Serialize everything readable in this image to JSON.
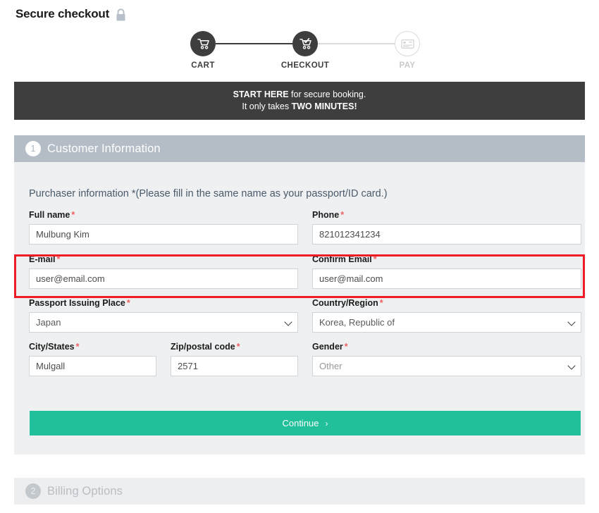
{
  "header": {
    "title": "Secure checkout",
    "lock_icon": "lock-icon"
  },
  "stepper": {
    "steps": [
      {
        "label": "CART",
        "icon": "shopping-cart-icon",
        "state": "done"
      },
      {
        "label": "CHECKOUT",
        "icon": "cart-check-icon",
        "state": "done"
      },
      {
        "label": "PAY",
        "icon": "credit-card-icon",
        "state": "todo"
      }
    ]
  },
  "banner": {
    "line1_strong": "START HERE",
    "line1_rest": " for secure booking.",
    "line2_rest": "It only takes ",
    "line2_strong": "TWO MINUTES!"
  },
  "sections": {
    "customer": {
      "number": "1",
      "title": "Customer Information"
    },
    "billing": {
      "number": "2",
      "title": "Billing Options"
    }
  },
  "form": {
    "note": "Purchaser information *(Please fill in the same name as your passport/ID card.)",
    "fields": {
      "full_name": {
        "label": "Full name",
        "required": "*",
        "value": "Mulbung Kim"
      },
      "phone": {
        "label": "Phone",
        "required": "*",
        "value": "821012341234"
      },
      "email": {
        "label": "E-mail",
        "required": "*",
        "value": "user@email.com"
      },
      "confirm_email": {
        "label": "Confirm Email",
        "required": "*",
        "value": "user@mail.com"
      },
      "passport_place": {
        "label": "Passport Issuing Place",
        "required": "*",
        "value": "Japan"
      },
      "country": {
        "label": "Country/Region",
        "required": "*",
        "value": "Korea, Republic of"
      },
      "city": {
        "label": "City/States",
        "required": "*",
        "value": "Mulgall"
      },
      "zip": {
        "label": "Zip/postal code",
        "required": "*",
        "value": "2571"
      },
      "gender": {
        "label": "Gender",
        "required": "*",
        "value": "Other"
      }
    },
    "continue_label": "Continue",
    "continue_chevron": "›"
  },
  "colors": {
    "accent_teal": "#21bf9a",
    "dark": "#3e3e3e",
    "section_active": "#b4bcc5",
    "section_inactive": "#eceef0",
    "highlight_red": "#ee1c25",
    "required_red": "#f06060",
    "panel_bg": "#eef0f2"
  }
}
